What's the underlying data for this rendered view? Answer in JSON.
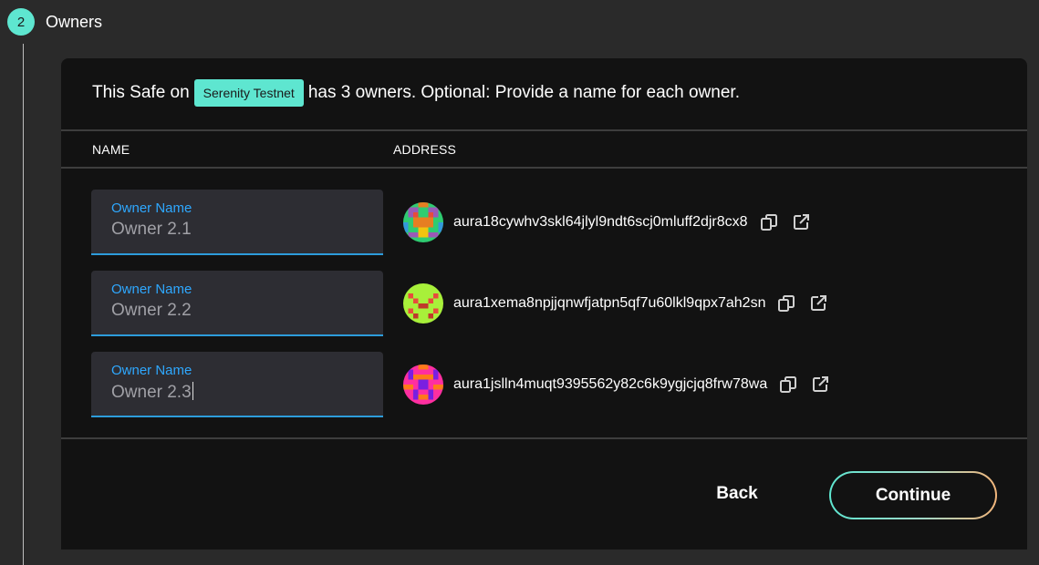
{
  "step": {
    "number": "2",
    "title": "Owners"
  },
  "intro": {
    "prefix": "This Safe on",
    "network": "Serenity Testnet",
    "suffix": "has 3 owners. Optional: Provide a name for each owner."
  },
  "columns": {
    "name": "NAME",
    "address": "ADDRESS"
  },
  "owners": [
    {
      "label": "Owner Name",
      "value": "Owner 2.1",
      "address": "aura18cywhv3skl64jlyl9ndt6scj0mluff2djr8cx8",
      "avatar_colors": [
        "#2ecc71",
        "#9b59b6",
        "#e67e22"
      ]
    },
    {
      "label": "Owner Name",
      "value": "Owner 2.2",
      "address": "aura1xema8npjjqnwfjatpn5qf7u60lkl9qpx7ah2sn",
      "avatar_colors": [
        "#a8f03a",
        "#e74c3c",
        "#a8f03a"
      ]
    },
    {
      "label": "Owner Name",
      "value": "Owner 2.3",
      "address": "aura1jslln4muqt9395562y82c6k9ygjcjq8frw78wa",
      "avatar_colors": [
        "#ff2fa0",
        "#7a1fe0",
        "#ff7a1a"
      ]
    }
  ],
  "buttons": {
    "back": "Back",
    "continue": "Continue"
  },
  "colors": {
    "accent": "#5ee6d0",
    "field_underline": "#2d9cdb",
    "field_label": "#2ea8ff",
    "card_bg": "#121212"
  }
}
